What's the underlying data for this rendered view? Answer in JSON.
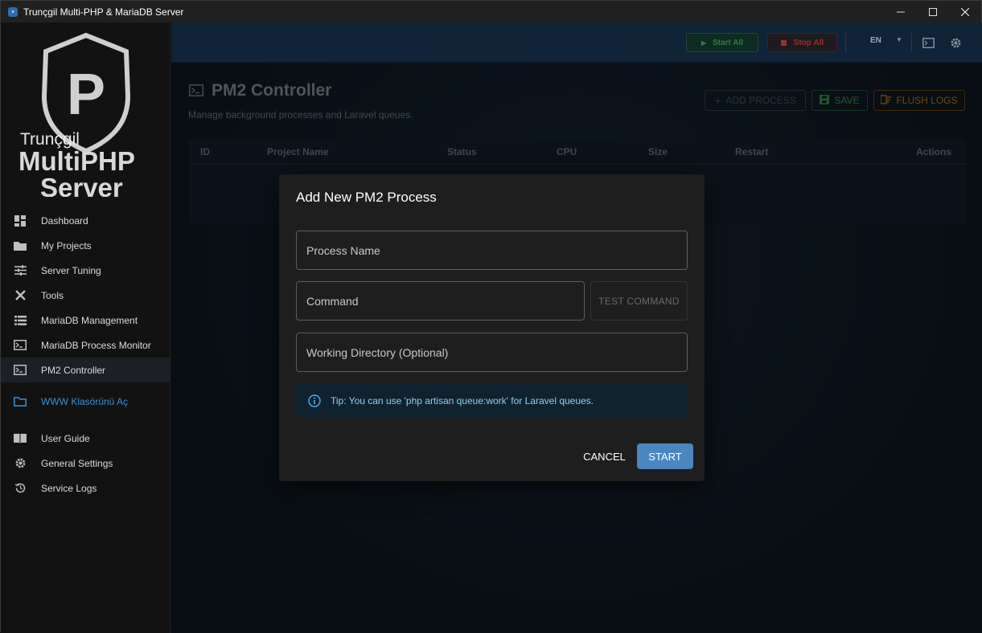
{
  "window": {
    "title": "Trunçgil Multi-PHP & MariaDB Server"
  },
  "logo": {
    "line1": "Trunçgil",
    "line2": "MultiPHP",
    "line3": "Server",
    "letter": "P"
  },
  "sidebar": {
    "items": [
      {
        "label": "Dashboard",
        "icon": "dashboard-icon"
      },
      {
        "label": "My Projects",
        "icon": "folder-icon"
      },
      {
        "label": "Server Tuning",
        "icon": "tune-icon"
      },
      {
        "label": "Tools",
        "icon": "tools-icon"
      },
      {
        "label": "MariaDB Management",
        "icon": "list-icon"
      },
      {
        "label": "MariaDB Process Monitor",
        "icon": "terminal-icon"
      },
      {
        "label": "PM2 Controller",
        "icon": "terminal-icon",
        "active": true
      },
      {
        "label": "WWW Klasörünü Aç",
        "icon": "folder-open-icon",
        "link": true
      },
      {
        "label": "User Guide",
        "icon": "book-icon"
      },
      {
        "label": "General Settings",
        "icon": "gear-icon"
      },
      {
        "label": "Service Logs",
        "icon": "history-icon"
      }
    ]
  },
  "header": {
    "start_all": "Start All",
    "stop_all": "Stop All",
    "language": "EN",
    "colors": {
      "start": "#2e7d42",
      "stop": "#9b2f2f"
    }
  },
  "page": {
    "title": "PM2 Controller",
    "subtitle": "Manage background processes and Laravel queues.",
    "add_process": "ADD PROCESS",
    "save": "SAVE",
    "flush_logs": "FLUSH LOGS"
  },
  "table": {
    "columns": [
      "ID",
      "Project Name",
      "Status",
      "CPU",
      "Size",
      "Restart",
      "Actions"
    ]
  },
  "modal": {
    "title": "Add New PM2 Process",
    "process_name": "Process Name",
    "command": "Command",
    "test_command": "TEST COMMAND",
    "working_directory": "Working Directory (Optional)",
    "tip": "Tip: You can use 'php artisan queue:work' for Laravel queues.",
    "cancel": "CANCEL",
    "start": "START",
    "accent": "#4a86c0"
  }
}
